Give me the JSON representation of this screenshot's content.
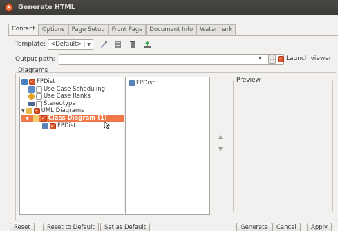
{
  "window": {
    "title": "Generate HTML"
  },
  "tabs": [
    {
      "label": "Content",
      "active": true
    },
    {
      "label": "Options",
      "active": false
    },
    {
      "label": "Page Setup",
      "active": false
    },
    {
      "label": "Front Page",
      "active": false
    },
    {
      "label": "Document Info",
      "active": false
    },
    {
      "label": "Watermark",
      "active": false
    }
  ],
  "template": {
    "label": "Template:",
    "value": "<Default>"
  },
  "output": {
    "label": "Output path:",
    "value": "",
    "launch_label": "Launch viewer",
    "launch_checked": true,
    "browse_label": "..."
  },
  "diagrams": {
    "label": "Diagrams"
  },
  "tree": {
    "items": [
      {
        "label": "FPDist",
        "checked": true,
        "icon": "project-icon"
      },
      {
        "label": "Use Case Scheduling",
        "checked": false,
        "icon": "model-icon"
      },
      {
        "label": "Use Case Ranks",
        "checked": false,
        "icon": "rank-icon"
      },
      {
        "label": "Stereotype",
        "checked": false,
        "icon": "stereotype-icon"
      },
      {
        "label": "UML Diagrams",
        "checked": true,
        "icon": "folder-icon"
      },
      {
        "label": "Class Diagram (1)",
        "checked": true,
        "icon": "folder-icon",
        "selected": true
      },
      {
        "label": "FPDist",
        "checked": true,
        "icon": "class-diagram-icon"
      }
    ]
  },
  "selected_list": {
    "items": [
      {
        "label": "FPDist",
        "icon": "class-diagram-icon"
      }
    ]
  },
  "preview": {
    "label": "Preview"
  },
  "buttons": {
    "reset": "Reset",
    "reset_default": "Reset to Default",
    "set_default": "Set as Default",
    "generate": "Generate",
    "cancel": "Cancel",
    "apply": "Apply"
  },
  "colors": {
    "accent": "#e0542a",
    "selection": "#f07746",
    "titlebar": "#3c3b37"
  }
}
